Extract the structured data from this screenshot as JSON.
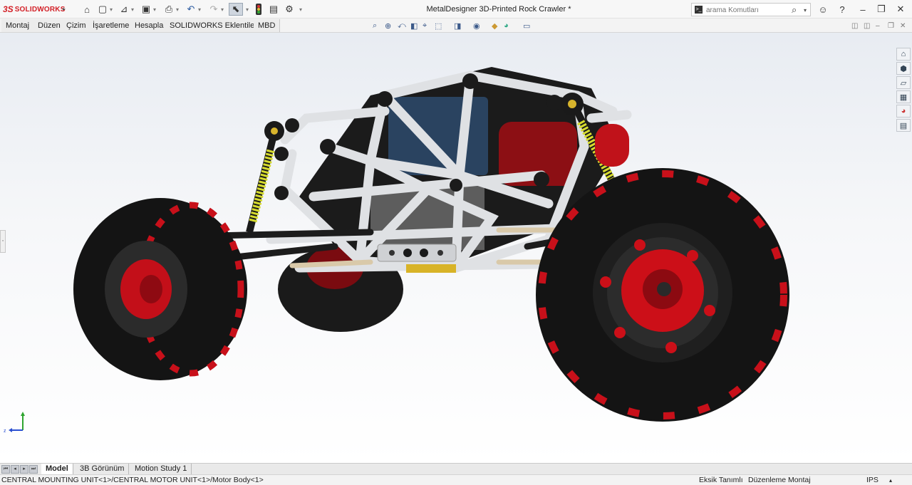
{
  "app": {
    "brand_ds": "3S",
    "brand_name": "SOLIDWORKS"
  },
  "window": {
    "title": "MetalDesigner 3D-Printed Rock Crawler *"
  },
  "quick_access": [
    {
      "name": "home-icon",
      "glyph": "⌂"
    },
    {
      "name": "new-document-icon",
      "glyph": "🗋"
    },
    {
      "name": "open-icon",
      "glyph": "📂"
    },
    {
      "name": "save-icon",
      "glyph": "💾"
    },
    {
      "name": "print-icon",
      "glyph": "🖶"
    },
    {
      "name": "undo-icon",
      "glyph": "↶"
    },
    {
      "name": "redo-icon",
      "glyph": "↷"
    },
    {
      "name": "select-cursor-icon",
      "glyph": "⬉"
    },
    {
      "name": "traffic-light-icon",
      "glyph": "●"
    },
    {
      "name": "file-properties-icon",
      "glyph": "▤"
    },
    {
      "name": "options-gear-icon",
      "glyph": "⚙"
    }
  ],
  "search": {
    "placeholder": "arama Komutları"
  },
  "command_tabs": [
    "Montaj",
    "Düzen",
    "Çizim",
    "İşaretleme",
    "Hesapla",
    "SOLIDWORKS Eklentileri",
    "MBD"
  ],
  "heads_up_tools": [
    "zoom-to-fit-icon",
    "zoom-to-area-icon",
    "previous-view-icon",
    "section-view-icon",
    "dynamic-annotation-icon",
    "view-orientation-icon",
    "display-style-icon",
    "hide-show-items-icon",
    "edit-appearance-icon",
    "apply-scene-icon",
    "view-settings-icon"
  ],
  "task_pane": [
    "solidworks-resources-icon",
    "design-library-icon",
    "file-explorer-icon",
    "view-palette-icon",
    "appearances-icon",
    "custom-properties-icon"
  ],
  "bottom_tabs": [
    "Model",
    "3B Görünüm",
    "Motion Study 1"
  ],
  "status": {
    "path": "CENTRAL MOUNTING UNIT<1>/CENTRAL MOTOR UNIT<1>/Motor Body<1>",
    "definition": "Eksik Tanımlı",
    "mode": "Düzenleme Montaj",
    "units": "IPS"
  },
  "colors": {
    "accent_red": "#d32027",
    "tire": "#141414",
    "rim_red": "#d0101a",
    "frame": "#dadcdf",
    "spring": "#cfd42a",
    "selection": "#cfd6df"
  }
}
